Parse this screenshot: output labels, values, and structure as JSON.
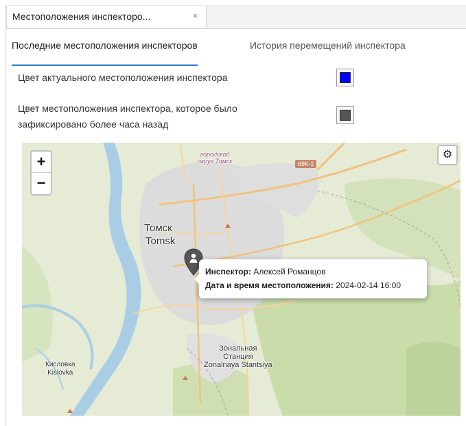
{
  "document_tab": {
    "title": "Местоположения инспекторо...",
    "close_glyph": "×"
  },
  "subtabs": [
    {
      "label": "Последние местоположения инспекторов",
      "active": true
    },
    {
      "label": "История перемещений инспектора",
      "active": false
    }
  ],
  "settings": {
    "current_color_label": "Цвет актуального местоположения инспектора",
    "current_color": "#0000ff",
    "old_color_label_line1": "Цвет местоположения инспектора, которое было",
    "old_color_label_line2": "зафиксировано более часа назад",
    "old_color": "#555555"
  },
  "map": {
    "zoom_in": "+",
    "zoom_out": "−",
    "settings_icon": "gear-icon",
    "settings_glyph": "⚙",
    "labels": {
      "tomsk_ru": "Томск",
      "tomsk_en": "Tomsk",
      "okrug_line1": "городской",
      "okrug_line2": "округ Томск",
      "road": "69К-1",
      "zonal_line1": "Зональная",
      "zonal_line2": "Станция",
      "zonal_line3": "Zonalnaya Stantsiya",
      "kislovka_ru": "Кисловка",
      "kislovka_en": "Kislovka"
    },
    "marker_icon": "inspector-marker-icon",
    "popup": {
      "inspector_label": "Инспектор:",
      "inspector_value": "Алексей Романцов",
      "datetime_label": "Дата и время местоположения:",
      "datetime_value": "2024-02-14 16:00"
    }
  }
}
